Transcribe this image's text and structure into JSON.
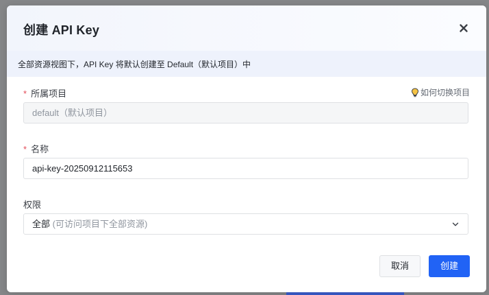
{
  "dialog": {
    "title": "创建 API Key",
    "notice": "全部资源视图下，API Key 将默认创建至 Default（默认项目）中"
  },
  "project": {
    "label": "所属项目",
    "required_mark": "*",
    "hint": "如何切换项目",
    "value": "default（默认项目）"
  },
  "name": {
    "label": "名称",
    "required_mark": "*",
    "value": "api-key-20250912115653"
  },
  "permission": {
    "label": "权限",
    "value": "全部",
    "description": "(可访问项目下全部资源)"
  },
  "footer": {
    "cancel_label": "取消",
    "create_label": "创建"
  },
  "colors": {
    "primary": "#2163f5",
    "required": "#e34d59",
    "notice_bg": "#eef2fc"
  }
}
